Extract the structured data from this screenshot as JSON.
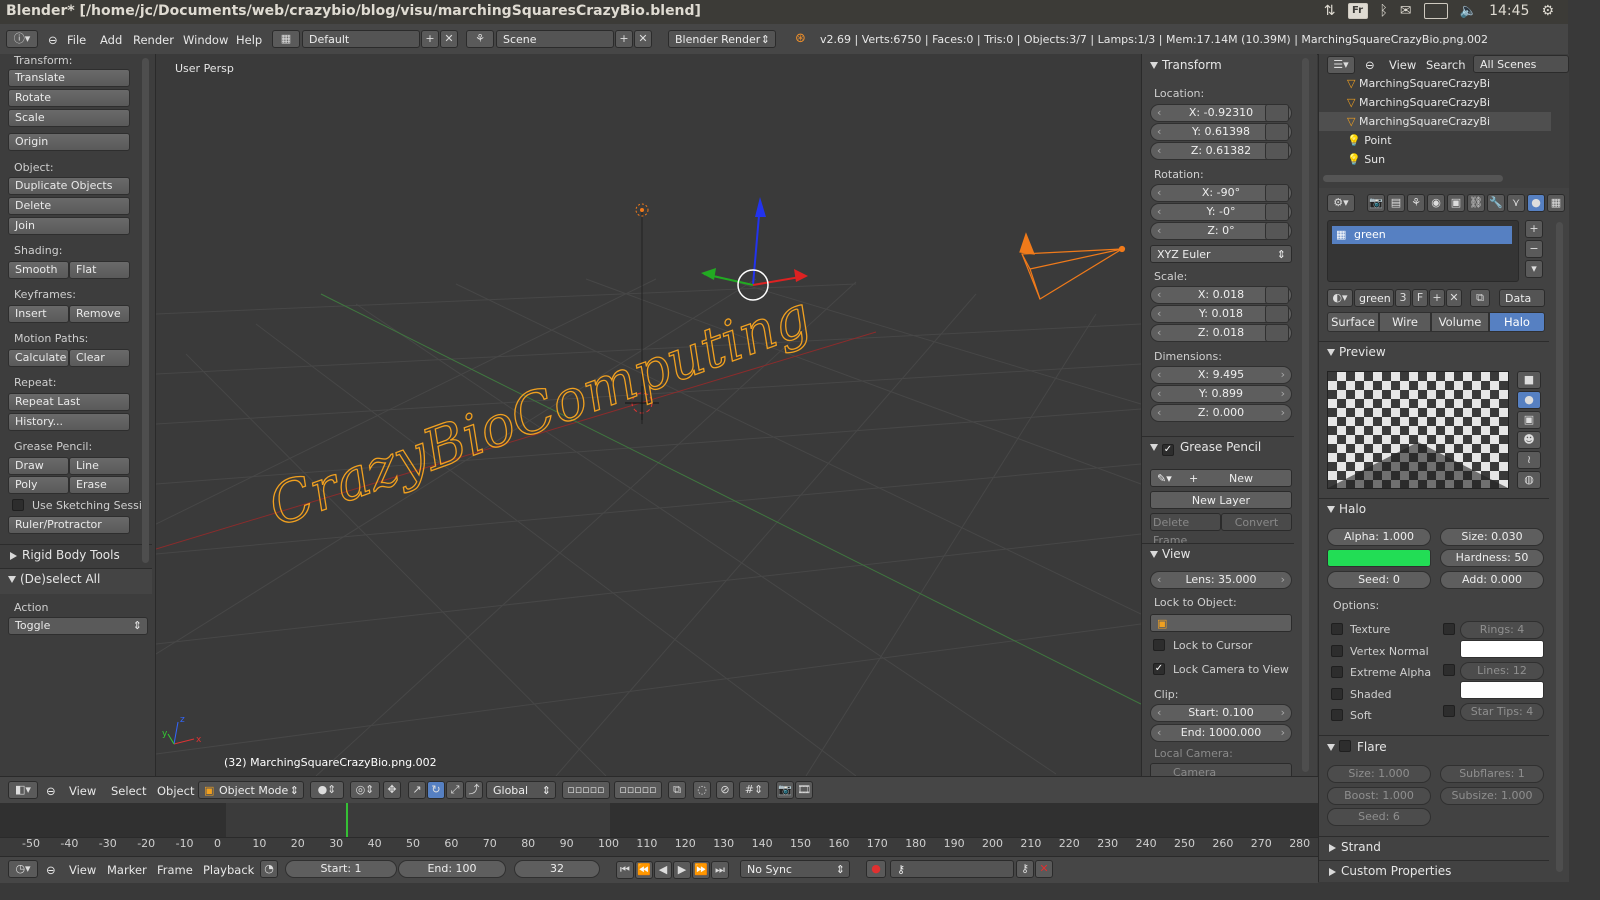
{
  "window": {
    "title": "Blender* [/home/jc/Documents/web/crazybio/blog/visu/marchingSquaresCrazyBio.blend]",
    "time": "14:45",
    "keyboard": "Fr"
  },
  "info_header": {
    "menus": [
      "File",
      "Add",
      "Render",
      "Window",
      "Help"
    ],
    "screen_layout": "Default",
    "scene": "Scene",
    "render_engine": "Blender Render",
    "stats": "v2.69 | Verts:6750 | Faces:0 | Tris:0 | Objects:3/7 | Lamps:1/3 | Mem:17.14M (10.39M) | MarchingSquareCrazyBio.png.002"
  },
  "tool_shelf": {
    "transform_label": "Transform:",
    "transform_buttons": [
      "Translate",
      "Rotate",
      "Scale"
    ],
    "origin": "Origin",
    "object_label": "Object:",
    "object_buttons": [
      "Duplicate Objects",
      "Delete",
      "Join"
    ],
    "shading_label": "Shading:",
    "smooth": "Smooth",
    "flat": "Flat",
    "keyframes_label": "Keyframes:",
    "insert": "Insert",
    "remove": "Remove",
    "motion_paths_label": "Motion Paths:",
    "calculate": "Calculate",
    "clear": "Clear",
    "repeat_label": "Repeat:",
    "repeat_last": "Repeat Last",
    "history": "History...",
    "grease_pencil_label": "Grease Pencil:",
    "draw": "Draw",
    "line": "Line",
    "poly": "Poly",
    "erase": "Erase",
    "use_sketching": "Use Sketching Sessi",
    "ruler": "Ruler/Protractor",
    "rigid_body_tools": "Rigid Body Tools",
    "deselect_all": "(De)select All",
    "action_label": "Action",
    "action_value": "Toggle"
  },
  "viewport": {
    "view_name": "User Persp",
    "object_info": "(32) MarchingSquareCrazyBio.png.002",
    "text_art": "CrazyBioComputing"
  },
  "n_panel": {
    "transform_header": "Transform",
    "location_label": "Location:",
    "location": [
      "X: -0.92310",
      "Y: 0.61398",
      "Z: 0.61382"
    ],
    "rotation_label": "Rotation:",
    "rotation": [
      "X: -90°",
      "Y: -0°",
      "Z: 0°"
    ],
    "rotation_mode": "XYZ Euler",
    "scale_label": "Scale:",
    "scale": [
      "X: 0.018",
      "Y: 0.018",
      "Z: 0.018"
    ],
    "dimensions_label": "Dimensions:",
    "dimensions": [
      "X: 9.495",
      "Y: 0.899",
      "Z: 0.000"
    ],
    "grease_header": "Grease Pencil",
    "new": "New",
    "new_layer": "New Layer",
    "delete_frame": "Delete Frame",
    "convert": "Convert",
    "view_header": "View",
    "lens": "Lens: 35.000",
    "lock_to_object_label": "Lock to Object:",
    "lock_to_cursor": "Lock to Cursor",
    "lock_camera": "Lock Camera to View",
    "clip_label": "Clip:",
    "clip_start": "Start: 0.100",
    "clip_end": "End: 1000.000",
    "local_camera_label": "Local Camera:",
    "camera": "Camera"
  },
  "outliner": {
    "view": "View",
    "search": "Search",
    "all_scenes": "All Scenes",
    "rows": [
      "MarchingSquareCrazyBi",
      "MarchingSquareCrazyBi",
      "MarchingSquareCrazyBi",
      "Point",
      "Sun"
    ]
  },
  "properties": {
    "material_slot": "green",
    "material_name": "green",
    "users": "3",
    "fake": "F",
    "data": "Data",
    "tabs": [
      "Surface",
      "Wire",
      "Volume",
      "Halo"
    ],
    "preview_header": "Preview",
    "halo_header": "Halo",
    "alpha": "Alpha: 1.000",
    "size": "Size: 0.030",
    "hardness": "Hardness: 50",
    "seed": "Seed: 0",
    "add": "Add: 0.000",
    "options_label": "Options:",
    "options": [
      "Texture",
      "Vertex Normal",
      "Extreme Alpha",
      "Shaded",
      "Soft"
    ],
    "rings": "Rings: 4",
    "lines": "Lines: 12",
    "star_tips": "Star Tips: 4",
    "flare_header": "Flare",
    "flare_size": "Size: 1.000",
    "subflares": "Subflares: 1",
    "boost": "Boost: 1.000",
    "subsize": "Subsize: 1.000",
    "flare_seed": "Seed: 6",
    "strand": "Strand",
    "custom_props": "Custom Properties",
    "halo_color": "#22dd55"
  },
  "view3d_header": {
    "menus": [
      "View",
      "Select",
      "Object"
    ],
    "mode": "Object Mode",
    "orientation": "Global"
  },
  "timeline": {
    "ticks": [
      "-50",
      "-40",
      "-30",
      "-20",
      "-10",
      "0",
      "10",
      "20",
      "30",
      "40",
      "50",
      "60",
      "70",
      "80",
      "90",
      "100",
      "110",
      "120",
      "130",
      "140",
      "150",
      "160",
      "170",
      "180",
      "190",
      "200",
      "210",
      "220",
      "230",
      "240",
      "250",
      "260",
      "270",
      "280"
    ],
    "menus": [
      "View",
      "Marker",
      "Frame",
      "Playback"
    ],
    "start": "Start: 1",
    "end": "End: 100",
    "current": "32",
    "sync": "No Sync"
  }
}
